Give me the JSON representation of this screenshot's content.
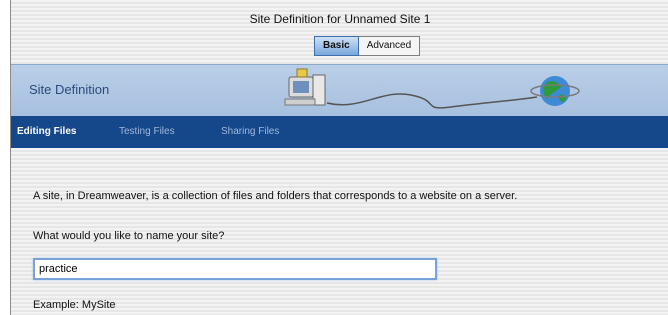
{
  "window": {
    "title": "Site Definition for Unnamed Site 1"
  },
  "tabs": [
    {
      "label": "Basic",
      "active": true
    },
    {
      "label": "Advanced",
      "active": false
    }
  ],
  "banner": {
    "title": "Site Definition"
  },
  "subnav": [
    {
      "label": "Editing Files",
      "active": true
    },
    {
      "label": "Testing Files",
      "active": false
    },
    {
      "label": "Sharing Files",
      "active": false
    }
  ],
  "content": {
    "description": "A site, in Dreamweaver, is a collection of files and folders that corresponds to a website on a server.",
    "question": "What would you like to name your site?",
    "site_name_value": "practice",
    "example": "Example: MySite"
  },
  "icons": [
    "computer-icon",
    "globe-icon",
    "network-cable-icon"
  ],
  "colors": {
    "banner": "#b9cfe8",
    "subnav": "#15478b",
    "tab_active": "#7aa7dd"
  }
}
